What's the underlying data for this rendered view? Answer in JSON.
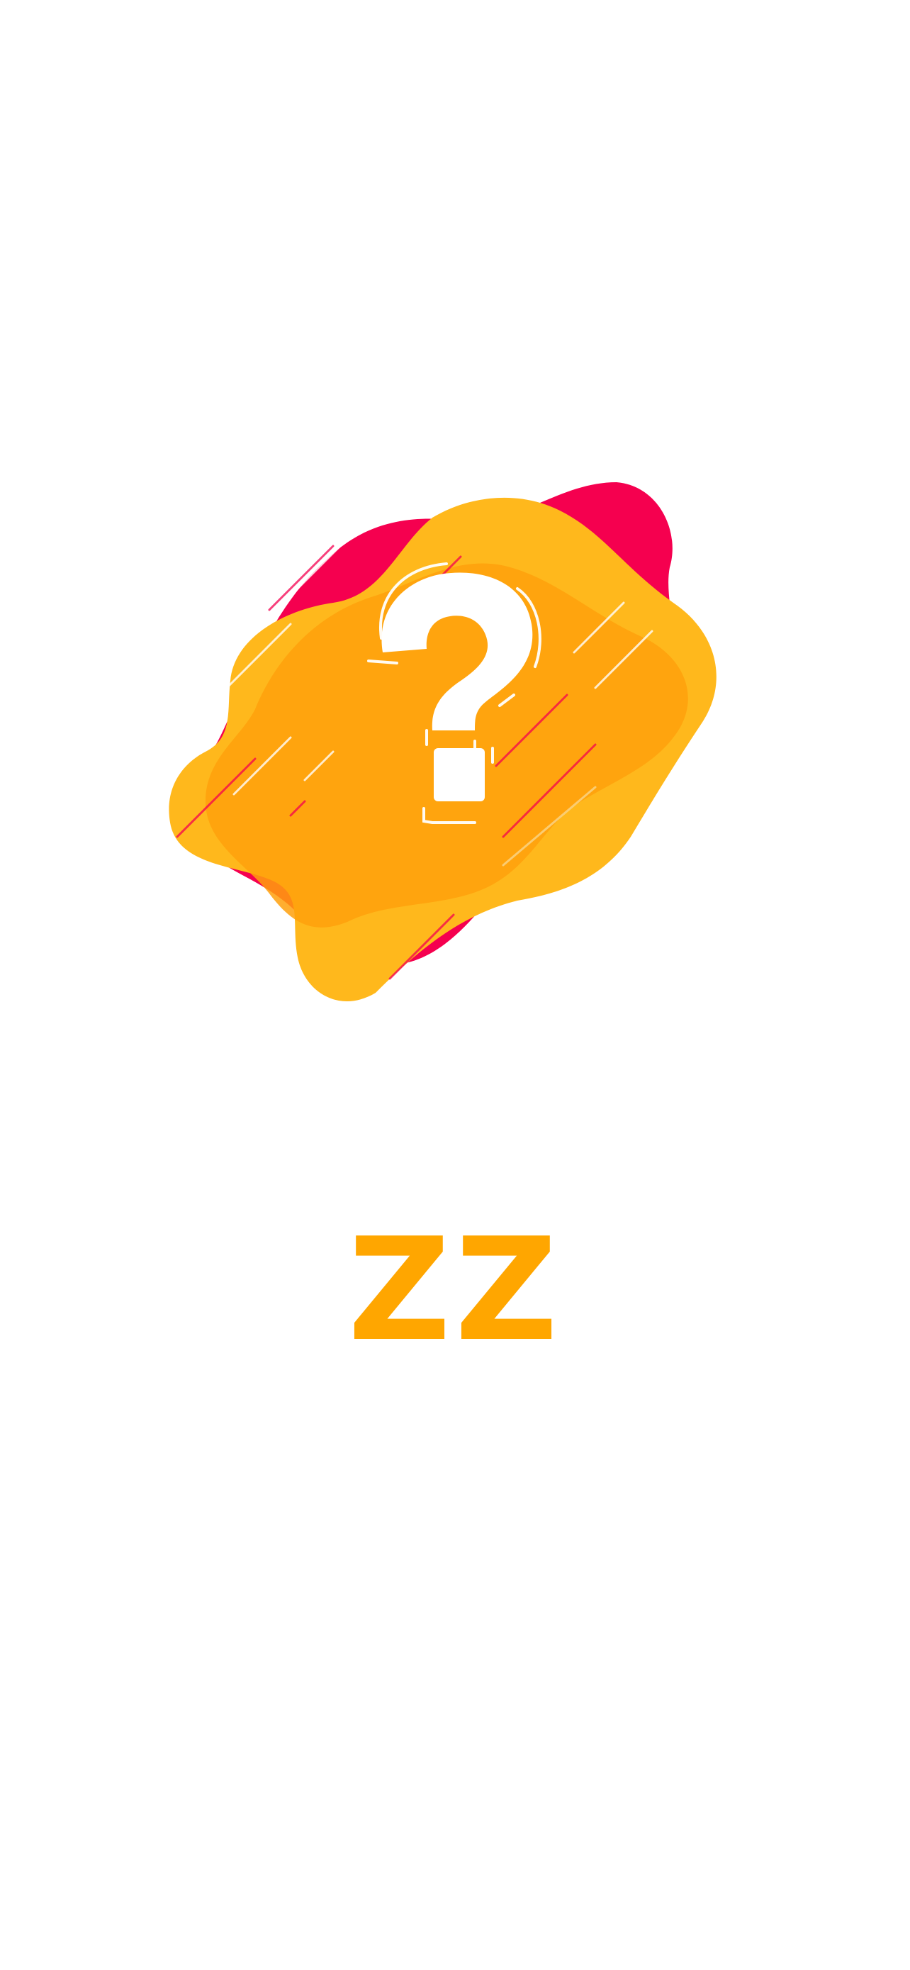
{
  "splash": {
    "app_name": "ZZ",
    "logo_icon": "question-mark-blob-icon"
  },
  "colors": {
    "accent": "#FFA600",
    "blob_pink": "#F5004F",
    "blob_yellow": "#FFB81C",
    "blob_orange": "#FFA00C",
    "background": "#FFFFFF"
  }
}
